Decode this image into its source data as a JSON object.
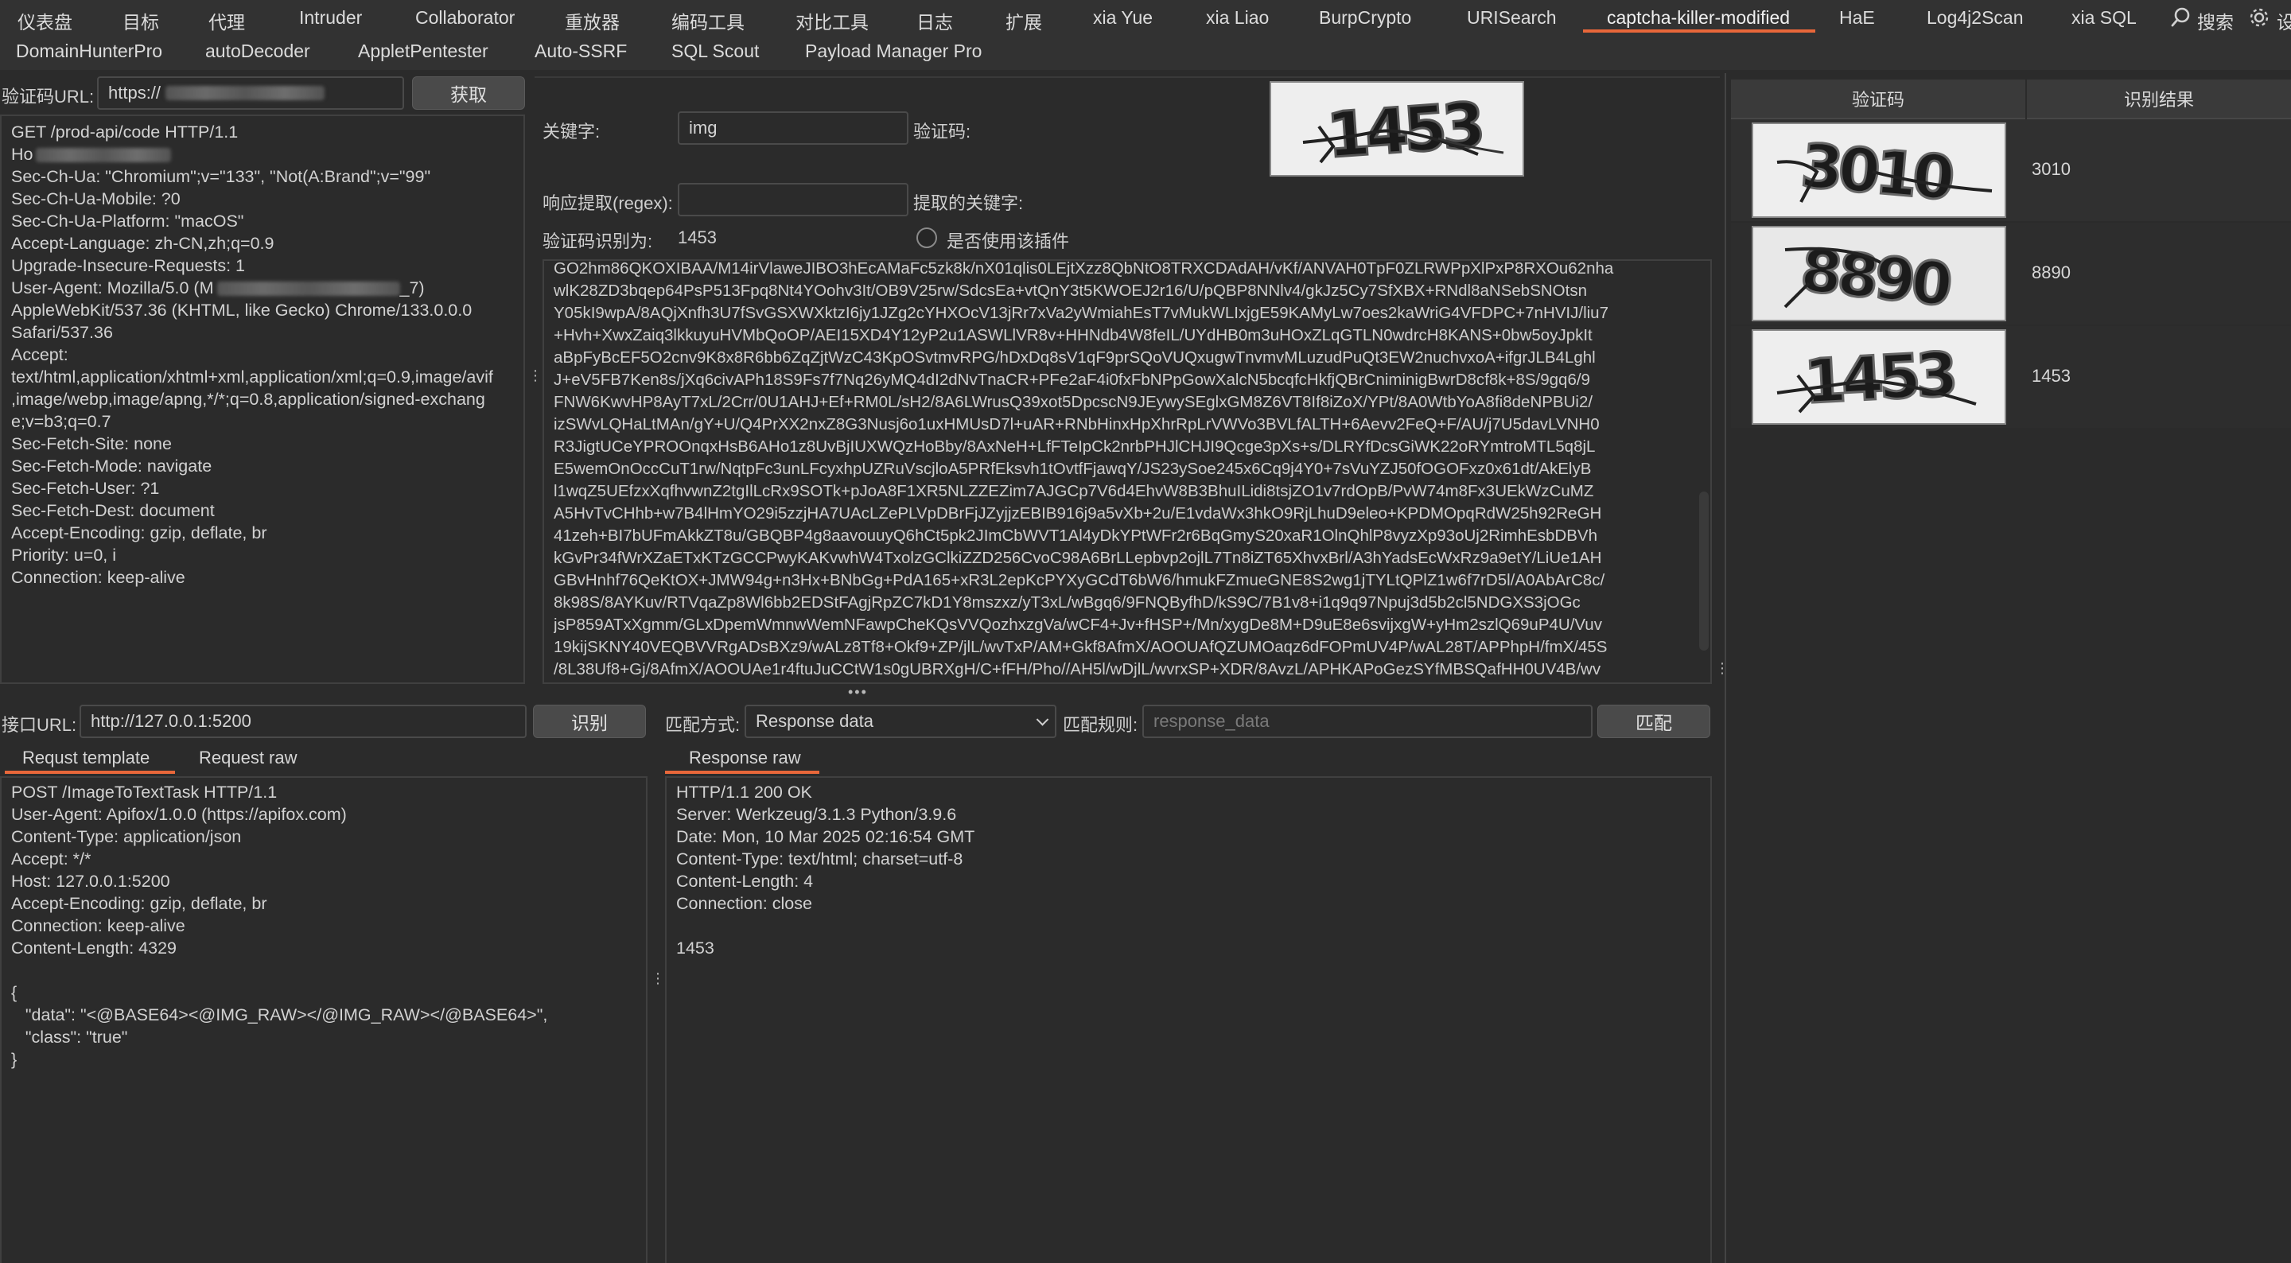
{
  "tabs_row1": [
    {
      "label": "仪表盘"
    },
    {
      "label": "目标"
    },
    {
      "label": "代理"
    },
    {
      "label": "Intruder"
    },
    {
      "label": "Collaborator"
    },
    {
      "label": "重放器"
    },
    {
      "label": "编码工具"
    },
    {
      "label": "对比工具"
    },
    {
      "label": "日志"
    },
    {
      "label": "扩展"
    },
    {
      "label": "xia Yue"
    },
    {
      "label": "xia Liao"
    },
    {
      "label": "BurpCrypto"
    },
    {
      "label": "URISearch"
    },
    {
      "label": "captcha-killer-modified"
    },
    {
      "label": "HaE"
    },
    {
      "label": "Log4j2Scan"
    },
    {
      "label": "xia SQL"
    }
  ],
  "search_label": "搜索",
  "settings_label": "设",
  "tabs_row2": [
    {
      "label": "DomainHunterPro"
    },
    {
      "label": "autoDecoder"
    },
    {
      "label": "AppletPentester"
    },
    {
      "label": "Auto-SSRF"
    },
    {
      "label": "SQL Scout"
    },
    {
      "label": "Payload Manager Pro"
    }
  ],
  "captcha_url": {
    "label": "验证码URL:",
    "value": "https://",
    "fetch_button": "获取"
  },
  "request_lines": [
    "GET /prod-api/code HTTP/1.1",
    "Ho",
    "Sec-Ch-Ua: \"Chromium\";v=\"133\", \"Not(A:Brand\";v=\"99\"",
    "Sec-Ch-Ua-Mobile: ?0",
    "Sec-Ch-Ua-Platform: \"macOS\"",
    "Accept-Language: zh-CN,zh;q=0.9",
    "Upgrade-Insecure-Requests: 1",
    "User-Agent: Mozilla/5.0 (M",
    "AppleWebKit/537.36 (KHTML, like Gecko) Chrome/133.0.0.0",
    "Safari/537.36",
    "Accept:",
    "text/html,application/xhtml+xml,application/xml;q=0.9,image/avif",
    ",image/webp,image/apng,*/*;q=0.8,application/signed-exchang",
    "e;v=b3;q=0.7",
    "Sec-Fetch-Site: none",
    "Sec-Fetch-Mode: navigate",
    "Sec-Fetch-User: ?1",
    "Sec-Fetch-Dest: document",
    "Accept-Encoding: gzip, deflate, br",
    "Priority: u=0, i",
    "Connection: keep-alive"
  ],
  "user_agent_tail": "_7)",
  "keyword": {
    "label": "关键字:",
    "value": "img"
  },
  "captcha_label": "验证码:",
  "captcha_preview_text": "1453",
  "regex": {
    "label": "响应提取(regex):",
    "value": "",
    "extracted_label": "提取的关键字:"
  },
  "recognized": {
    "label": "验证码识别为:",
    "value": "1453"
  },
  "use_plugin_label": "是否使用该插件",
  "base64_lines": [
    "GO2hm86QKOXIBAA/M14irVlawеJIBO3hEcAMaFc5zk8k/nX01qlis0LEjtXzz8QbNtO8TRXCDAdAH/vKf/ANVAH0TpF0ZLRWPpXlPxP8RXOu62nha",
    "wlK28ZD3bqep64PsP513Fpq8Nt4YOohv3It/OB9V25rw/SdcsEa+vtQnY3t5KWOEJ2r16/U/pQBP8NNlv4/gkJz5Cy7SfXBX+RNdl8aNSebSNOtsn",
    "Y05kI9wpA/8AQjXnfh3U7fSvGSXWXktzI6jy1JZg2cYHXOcV13jRr7xVa2yWmiahEsT7vMukWLIxjgE59KAMyLw7oes2kaWriG4VFDPC+7nHVIJ/liu7",
    "+Hvh+XwxZaiq3lkkuyuHVMbQoOP/AEI15XD4Y12yP2u1ASWLlVR8v+HHNdb4W8feIL/UYdHB0m3uHOxZLqGTLN0wdrcH8KANS+0bw5oyJpkIt",
    "aBpFyBcEF5O2cnv9K8x8R6bb6ZqZjtWzC43KpOSvtmvRPG/hDxDq8sV1qF9prSQoVUQxugwTnvmvMLuzudPuQt3EW2nuchvxoA+ifgrJLB4Lghl",
    "J+eV5FB7Ken8s/jXq6civAPh18S9Fs7f7Nq26yMQ4dI2dNvTnaCR+PFe2aF4i0fxFbNPpGowXalcN5bcqfcHkfjQBrCniminigBwrD8cf8k+8S/9gq6/9",
    "FNW6KwvHP8AyT7xL/2Crr/0U1AHJ+Ef+RM0L/sH2/8A6LWrusQ39xot5DpcscN9JEywySEglxGM8Z6VT8If8iZoX/YPt/8A0WtbYoA8fi8deNPBUi2/",
    "izSWvLQHaLtMAn/gY+U/Q4PrXX2nxZ8G3Nusj6o1uxHMUsD7l+uAR+RNbHinxHpXhrRpLrVWVo3BVLfALTH+6Aevv2FeQ+F/AU/j7U5davLVNH0",
    "R3JigtUCeYPROOnqxHsB6AHo1z8UvBjIUXWQzHoBby/8AxNeH+LfFTeIpCk2nrbPHJlCHJI9Qcge3pXs+s/DLRYfDcsGiWK22oRYmtroMTL5q8jL",
    "E5wemOnOccCuT1rw/NqtpFc3unLFcyxhpUZRuVscjloA5PRfEksvh1tOvtfFjawqY/JS23ySoe245x6Cq9j4Y0+7sVuYZJ50fOGOFxz0x61dt/AkElyB",
    "l1wqZ5UEfzxXqfhvwnZ2tgIlLcRx9SOTk+pJoA8F1XR5NLZZEZim7AJGCp7V6d4EhvW8B3BhuILidi8tsjZO1v7rdOpB/PvW74m8Fx3UEkWzCuMZ",
    "A5HvTvCHhb+w7B4lHmYO29i5zzjHA7UAcLZePLVpDBrFjJZyjjzEBIB916j9a5vXb+2u/E1vdaWx3hkO9RjLhuD9eleo+KPDMOpqRdW25h92ReGH",
    "41zeh+BI7bUFmAkkZT8u/GBQBP4g8aavouuyQ6hCt5pk2JImCbWVT1Al4yDkYPtWFr2r6BqGmyS20xaR1OlnQhlP8vyzXp93oUj2RimhEsbDBVh",
    "kGvPr34fWrXZaETxKTzGCCPwyKAKvwhW4TxolzGClkiZZD256CvoC98A6BrLLepbvp2ojlL7Tn8iZT65XhvxBrl/A3hYadsEcWxRz9a9etY/LiUe1AH",
    "GBvHnhf76QeKtOX+JMW94g+n3Hx+BNbGg+PdA165+xR3L2epKcPYXyGCdT6bW6/hmukFZmueGNE8S2wg1jTYLtQPlZ1w6f7rD5l/A0AbArC8c/",
    "8k98S/8AYKuv/RTVqaZp8Wl6bb2EDStFAgjRpZC7kD1Y8mszxz/yT3xL/wBgq6/9FNQByfhD/kS9C/7B1v8+i1q9q97Npuj3d5b2cl5NDGXS3jOGc",
    "jsP859ATxXgmm/GLxDpemWmnwWemNFawpCheKQsVVQozhxzgVa/wCF4+Jv+fHSP+/Mn/xygDe8M+D9uE8e6svijxgW+yHm2szlQ69uP4U/Vuv",
    "19kijSKNY40VEQBVVRgADsBXz9/wALz8Tf8+Okf9+ZP/jlL/wvTxP/AM+Gkf8AfmX/AOOUAfQZUMOaqz6dFOPmUV4P/wAL28T/APPhpH/fmX/45S",
    "/8L38Uf8+Gj/8AfmX/AOOUAe1r4ftuJuCCtW1s0gUBRXgH/C+fFH/Pho//AH5l/wDjlL/wvrxSP+XDR/8AvzL/APHKAPoGezSYfMBSQafHH0UV4B/wv"
  ],
  "api_url": {
    "label": "接口URL:",
    "value": "http://127.0.0.1:5200",
    "recognize_button": "识别"
  },
  "match": {
    "mode_label": "匹配方式:",
    "mode_value": "Response data",
    "rule_label": "匹配规则:",
    "rule_placeholder": "response_data",
    "match_button": "匹配"
  },
  "request_tabs": [
    {
      "label": "Requst template"
    },
    {
      "label": "Request raw"
    }
  ],
  "request_template_lines": [
    "POST /ImageToTextTask HTTP/1.1",
    "User-Agent: Apifox/1.0.0 (https://apifox.com)",
    "Content-Type: application/json",
    "Accept: */*",
    "Host: 127.0.0.1:5200",
    "Accept-Encoding: gzip, deflate, br",
    "Connection: keep-alive",
    "Content-Length: 4329",
    "",
    "{",
    "   \"data\": \"<@BASE64><@IMG_RAW></@IMG_RAW></@BASE64>\",",
    "   \"class\": \"true\"",
    "}"
  ],
  "response_tab": {
    "label": "Response raw"
  },
  "response_lines": [
    "HTTP/1.1 200 OK",
    "Server: Werkzeug/3.1.3 Python/3.9.6",
    "Date: Mon, 10 Mar 2025 02:16:54 GMT",
    "Content-Type: text/html; charset=utf-8",
    "Content-Length: 4",
    "Connection: close",
    "",
    "1453"
  ],
  "results_table": {
    "headers": [
      "验证码",
      "识别结果"
    ],
    "rows": [
      {
        "image_text": "3010",
        "result": "3010"
      },
      {
        "image_text": "8890",
        "result": "8890"
      },
      {
        "image_text": "1453",
        "result": "1453"
      }
    ]
  },
  "colors": {
    "background": "#2b2b2b",
    "tab_bar": "#323232",
    "accent": "#e8673a",
    "button": "#4a4a4a"
  }
}
